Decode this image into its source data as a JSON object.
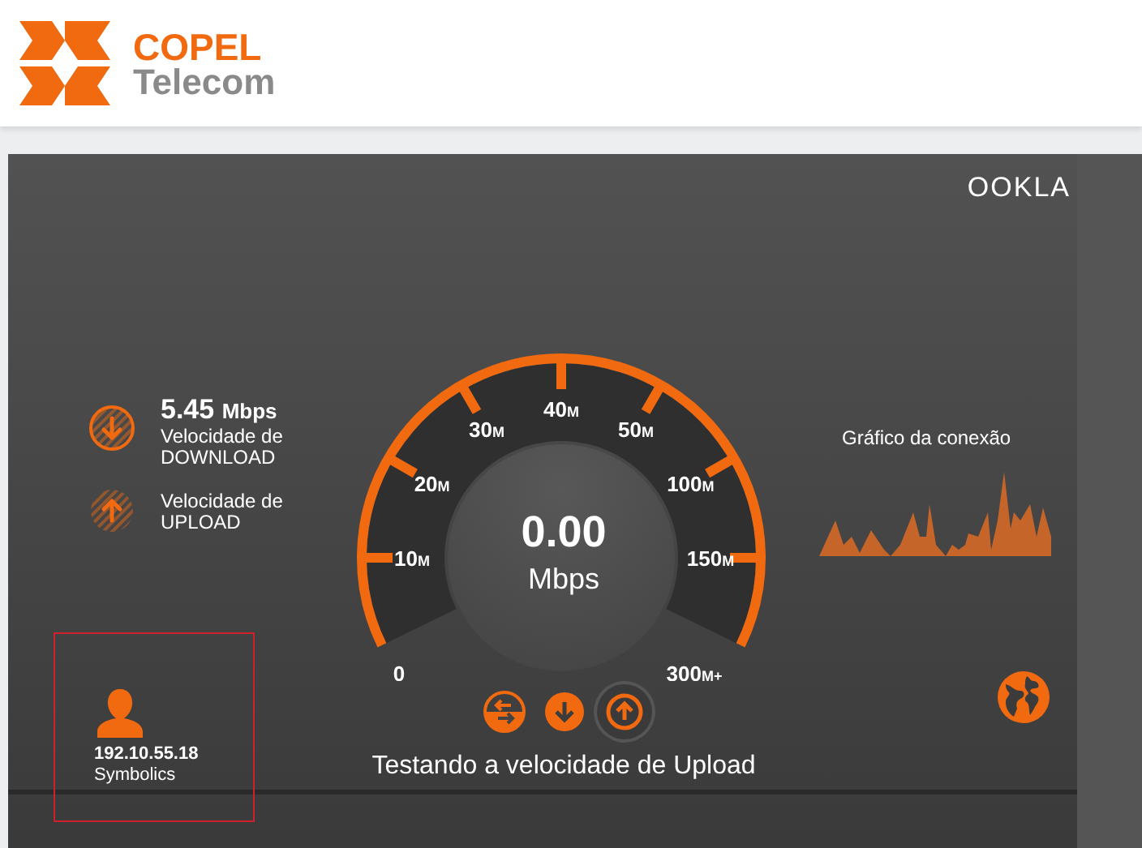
{
  "header": {
    "logo_line_1": "COPEL",
    "logo_line_2": "Telecom"
  },
  "brand": "OOKLA",
  "results": [
    {
      "kind": "download",
      "completed": true,
      "value": "5.45",
      "unit": "Mbps",
      "label_1": "Velocidade de",
      "label_2": "DOWNLOAD"
    },
    {
      "kind": "upload",
      "completed": false,
      "label_1": "Velocidade de",
      "label_2": "UPLOAD"
    }
  ],
  "gauge": {
    "reading": "0.00",
    "unit": "Mbps",
    "labels": [
      {
        "value": "0"
      },
      {
        "value": "10",
        "unit": "M"
      },
      {
        "value": "20",
        "unit": "M"
      },
      {
        "value": "30",
        "unit": "M"
      },
      {
        "value": "40",
        "unit": "M"
      },
      {
        "value": "50",
        "unit": "M"
      },
      {
        "value": "100",
        "unit": "M"
      },
      {
        "value": "150",
        "unit": "M"
      },
      {
        "value": "300",
        "unit": "M+"
      }
    ]
  },
  "test_buttons": [
    {
      "kind": "ping",
      "selected": false
    },
    {
      "kind": "download",
      "selected": false
    },
    {
      "kind": "upload",
      "selected": true
    }
  ],
  "status": "Testando a velocidade de Upload",
  "graph": {
    "title": "Gráfico da conexão"
  },
  "client": {
    "ip": "192.10.55.18",
    "provider": "Symbolics",
    "highlighted": true
  }
}
